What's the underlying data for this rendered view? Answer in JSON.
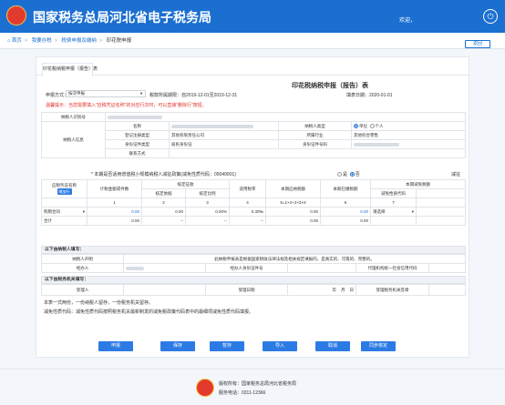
{
  "header": {
    "title": "国家税务总局河北省电子税务局",
    "welcome": "欢迎，",
    "exit_icon": "⏻"
  },
  "breadcrumb": {
    "home": "首页",
    "level1": "我要办税",
    "level2": "税费申报及缴纳",
    "current": "印花税申报",
    "back": "返回"
  },
  "tab": {
    "label": "印花税纳税申报（报告）表"
  },
  "form": {
    "title": "印花税纳税申报（报告）表",
    "declare_mode_label": "申报方式：",
    "declare_mode_value": "按次申报",
    "period_label": "税款所属期限：自2019-12-01至2019-12-31",
    "fill_date": "填表日期：2020-01-01",
    "tip": "温馨提示：当您需要填入“应税凭证名称”的对应行次时，可以直接“删除行”按钮。",
    "taxpayer_id_label": "纳税人识别号",
    "taxpayer_info_label": "纳税人信息",
    "name_label": "名称",
    "taxpayer_type_label": "纳税人类型",
    "type_unit": "单位",
    "type_person": "个人",
    "reg_type_label": "登记注册类型",
    "reg_type_value": "其他有限责任公司",
    "industry_label": "所属行业",
    "industry_value": "其他综合零售",
    "id_type_label": "身份证件类型",
    "id_type_value": "居民身份证",
    "id_no_label": "身份证件号码",
    "contact_label": "联系方式",
    "small_scale_q": "* 本期是否适用增值税小规模纳税人减征政策(减免性质代码：09049901)",
    "yes": "是",
    "no": "否",
    "reduce_label": "减征",
    "col_item": "应税凭证名称",
    "add_row": "增加行",
    "col_amount": "计税金额或件数",
    "col_verify": "核定征收",
    "col_basis": "核定依据",
    "col_ratio": "核定比例",
    "col_rate": "适用税率",
    "col_due": "本期应纳税额",
    "col_paid": "本期已缴税额",
    "col_relief": "本期减免税额",
    "col_relief_code": "减免性质代码",
    "col_nums": [
      "1",
      "2",
      "3",
      "4",
      "5=1×4+2×3×4",
      "6",
      "7"
    ],
    "row_name": "购销合同",
    "row_vals": [
      "0.00",
      "0.00",
      "0.00%",
      "0.30‰",
      "0.00",
      "0.00"
    ],
    "select_placeholder": "请选择",
    "total_label": "合计",
    "total_vals": [
      "0.00",
      "--",
      "--",
      "--",
      "0.00",
      "0.00"
    ],
    "sec_taxpayer": "以下由纳税人填写：",
    "decl_label": "纳税人声明",
    "decl_text": "此纳税申报表是根据国家税收法律法规及相关规定填报的，是真实的、可靠的、完整的。",
    "handler_label": "经办人",
    "handler_id_label": "经办人身份证件号",
    "agent_code_label": "代理机构统一社会信用代码",
    "sec_tax_office": "以下由税务机关填写：",
    "receiver_label": "受理人",
    "receive_date_label": "受理日期",
    "year_label": "年",
    "month_label": "月",
    "day_label": "日",
    "office_seal_label": "受理税务机关签章",
    "note1": "本表一式两份，一份纳税人留存，一份税务机关留存。",
    "note2": "减免性质代码：减免性质代码按照税务机关最新制发的减免税政策代码表中的最细项减免性质代码填报。"
  },
  "buttons": [
    "申报",
    "保存",
    "暂存",
    "导入",
    "取消",
    "同步核定"
  ],
  "footer": {
    "l1": "版权所有：国家税务总局河北省税务局",
    "l2": "服务电话：0311-12366"
  }
}
